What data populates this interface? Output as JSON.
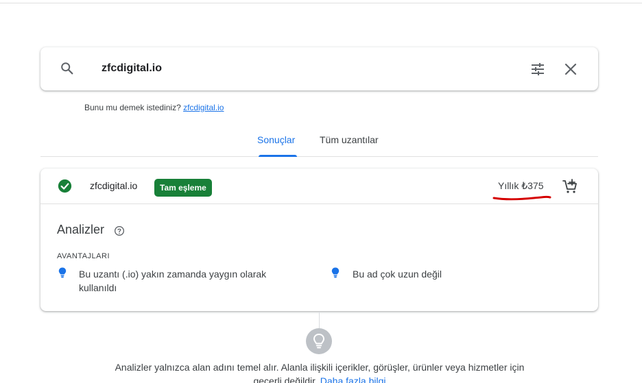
{
  "search": {
    "query": "zfcdigital.io"
  },
  "suggestion": {
    "prefix": "Bunu mu demek istediniz?",
    "link": "zfcdigital.io"
  },
  "tabs": [
    {
      "label": "Sonuçlar",
      "active": true
    },
    {
      "label": "Tüm uzantılar",
      "active": false
    }
  ],
  "result": {
    "domain": "zfcdigital.io",
    "badge": "Tam eşleme",
    "price": "Yıllık ₺375"
  },
  "analysis": {
    "title": "Analizler",
    "section_label": "AVANTAJLARI",
    "advantages": [
      "Bu uzantı (.io) yakın zamanda yaygın olarak kullanıldı",
      "Bu ad çok uzun değil"
    ]
  },
  "footer": {
    "text": "Analizler yalnızca alan adını temel alır. Alanla ilişkili içerikler, görüşler, ürünler veya hizmetler için geçerli değildir.",
    "link": "Daha fazla bilgi"
  },
  "colors": {
    "accent": "#1a73e8",
    "badge_green": "#188038",
    "annotation_red": "#d50000"
  },
  "icons": [
    "search-icon",
    "tune-icon",
    "close-icon",
    "check-circle-icon",
    "add-cart-icon",
    "help-icon",
    "lightbulb-icon"
  ]
}
